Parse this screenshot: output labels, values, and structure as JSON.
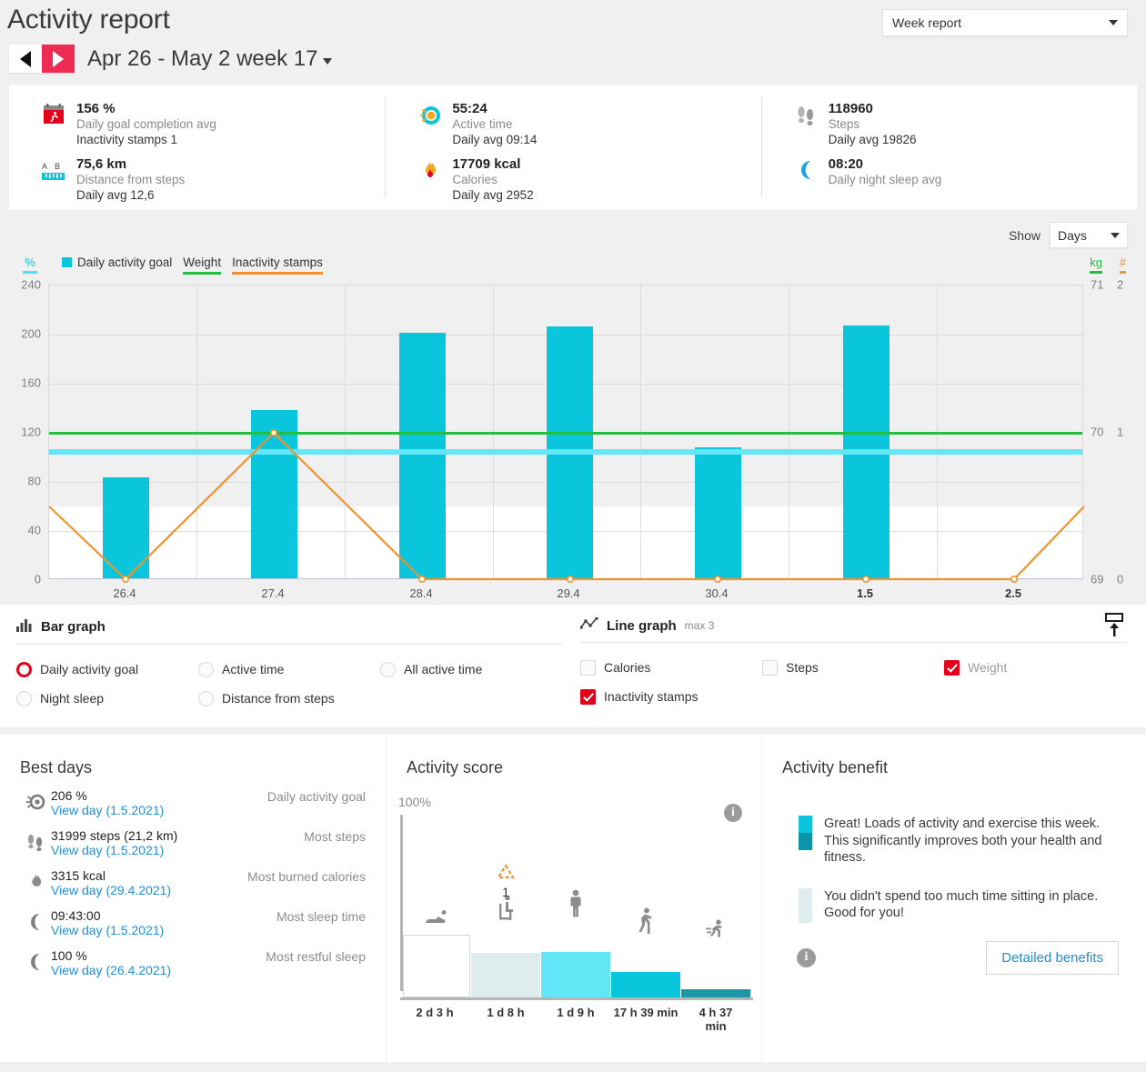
{
  "header": {
    "title": "Activity report",
    "report_select": {
      "value": "Week report",
      "icon": "chevron-down-icon"
    },
    "prev_icon": "triangle-left-icon",
    "next_icon": "triangle-right-icon",
    "week_label": "Apr 26 - May 2 week 17"
  },
  "summary": [
    {
      "icon": "calendar-run-icon",
      "value": "156 %",
      "label": "Daily goal completion avg",
      "sub": "Inactivity stamps 1"
    },
    {
      "icon": "activity-ring-icon",
      "value": "55:24",
      "label": "Active time",
      "sub": "Daily avg 09:14"
    },
    {
      "icon": "footsteps-icon",
      "value": "118960",
      "label": "Steps",
      "sub": "Daily avg 19826"
    },
    {
      "icon": "ruler-icon",
      "value": "75,6 km",
      "label": "Distance from steps",
      "sub": "Daily avg 12,6"
    },
    {
      "icon": "flame-icon",
      "value": "17709 kcal",
      "label": "Calories",
      "sub": "Daily avg 2952"
    },
    {
      "icon": "moon-icon",
      "value": "08:20",
      "label": "Daily night sleep avg",
      "sub": ""
    }
  ],
  "chart_toolbar": {
    "show_label": "Show",
    "show_value": "Days",
    "show_icon": "chevron-down-icon"
  },
  "chart_data": {
    "type": "bar",
    "title": "",
    "categories": [
      "26.4",
      "27.4",
      "28.4",
      "29.4",
      "30.4",
      "1.5",
      "2.5"
    ],
    "bold_categories": [
      "1.5",
      "2.5"
    ],
    "series": [
      {
        "name": "Daily activity goal",
        "type": "bar",
        "color": "#0ac6dd",
        "unit": "%",
        "values": [
          82,
          137,
          200,
          205,
          107,
          206,
          0
        ]
      },
      {
        "name": "Weight",
        "type": "line",
        "color": "#20bf3f",
        "unit": "kg",
        "values": [
          70,
          70,
          70,
          70,
          70,
          70,
          70
        ]
      },
      {
        "name": "Inactivity stamps",
        "type": "line",
        "color": "#f0922d",
        "unit": "#",
        "values": [
          0.5,
          1,
          0,
          0,
          0,
          0,
          0
        ]
      }
    ],
    "legend": [
      {
        "label": "Daily activity goal",
        "marker": "square",
        "color": "#0ac6dd"
      },
      {
        "label": "Weight",
        "marker": "underline",
        "color": "#20bf3f"
      },
      {
        "label": "Inactivity stamps",
        "marker": "underline",
        "color": "#f0922d"
      }
    ],
    "legend_position": "top-left",
    "grid": true,
    "y_left": {
      "unit": "%",
      "ticks": [
        "240",
        "200",
        "160",
        "120",
        "80",
        "40",
        "0"
      ],
      "min": 0,
      "max": 240
    },
    "y_right_kg": {
      "unit": "kg",
      "ticks": [
        "71",
        "70",
        "69"
      ],
      "min": 69,
      "max": 71
    },
    "y_right_count": {
      "unit": "#",
      "ticks": [
        "2",
        "1",
        "0"
      ],
      "min": 0,
      "max": 2
    },
    "goal_line_value": 100,
    "goal_line_color": "#63e6f5"
  },
  "bar_graph": {
    "title": "Bar graph",
    "icon": "bar-chart-icon",
    "options": [
      {
        "label": "Daily activity goal",
        "selected": true
      },
      {
        "label": "Active time",
        "selected": false
      },
      {
        "label": "All active time",
        "selected": false
      },
      {
        "label": "Night sleep",
        "selected": false
      },
      {
        "label": "Distance from steps",
        "selected": false
      }
    ]
  },
  "line_graph": {
    "title": "Line graph",
    "max_note": "max 3",
    "icon": "line-chart-icon",
    "export_icon": "export-icon",
    "options": [
      {
        "label": "Calories",
        "checked": false
      },
      {
        "label": "Steps",
        "checked": false
      },
      {
        "label": "Weight",
        "checked": true
      },
      {
        "label": "Inactivity stamps",
        "checked": true
      }
    ]
  },
  "best_days": {
    "title": "Best days",
    "rows": [
      {
        "icon": "activity-goal-icon",
        "value": "206 %",
        "link": "View day (1.5.2021)",
        "label": "Daily activity goal"
      },
      {
        "icon": "footsteps-icon",
        "value": "31999 steps (21,2 km)",
        "link": "View day (1.5.2021)",
        "label": "Most steps"
      },
      {
        "icon": "flame-icon",
        "value": "3315 kcal",
        "link": "View day (29.4.2021)",
        "label": "Most burned calories"
      },
      {
        "icon": "moon-icon",
        "value": "09:43:00",
        "link": "View day (1.5.2021)",
        "label": "Most sleep time"
      },
      {
        "icon": "moon-icon",
        "value": "100 %",
        "link": "View day (26.4.2021)",
        "label": "Most restful sleep"
      }
    ]
  },
  "activity_score": {
    "title": "Activity score",
    "y_max_label": "100%",
    "info_icon": "info-icon",
    "stamp_badge": {
      "icon": "inactivity-triangle-icon",
      "count": "1"
    },
    "bars": [
      {
        "label": "2 d 3 h",
        "icon": "lying-icon",
        "color": "#ffffff",
        "border": "#d5d5d5",
        "height_pct": 100
      },
      {
        "label": "1 d 8 h",
        "icon": "sitting-icon",
        "color": "#dfeced",
        "border": "",
        "height_pct": 71
      },
      {
        "label": "1 d 9 h",
        "icon": "standing-icon",
        "color": "#63e6f5",
        "border": "",
        "height_pct": 72
      },
      {
        "label": "17 h 39 min",
        "icon": "walking-icon",
        "color": "#0ac6dd",
        "border": "",
        "height_pct": 40
      },
      {
        "label": "4 h 37 min",
        "icon": "running-icon",
        "color": "#1b97a8",
        "border": "",
        "height_pct": 9
      }
    ]
  },
  "activity_benefit": {
    "title": "Activity benefit",
    "items": [
      {
        "bar_colors": [
          "#0ac6dd",
          "#0a96a8"
        ],
        "text": "Great! Loads of activity and exercise this week. This significantly improves both your health and fitness."
      },
      {
        "bar_colors": [
          "#dfeced"
        ],
        "text": "You didn't spend too much time sitting in place. Good for you!"
      }
    ],
    "info_icon": "info-icon",
    "button_label": "Detailed benefits"
  }
}
